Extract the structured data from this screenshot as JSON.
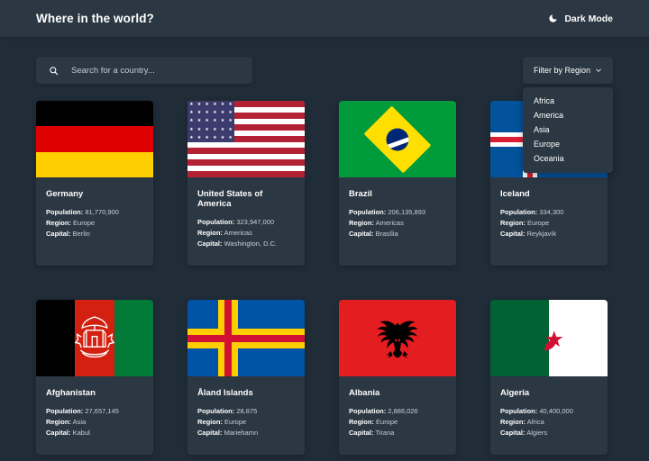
{
  "header": {
    "title": "Where in the world?",
    "theme_toggle_label": "Dark Mode",
    "theme_toggle_icon": "moon-icon"
  },
  "controls": {
    "search": {
      "icon": "search-icon",
      "placeholder": "Search for a country...",
      "value": ""
    },
    "filter": {
      "label": "Filter by Region",
      "icon": "chevron-down-icon",
      "expanded": true,
      "options": [
        "Africa",
        "America",
        "Asia",
        "Europe",
        "Oceania"
      ]
    }
  },
  "labels": {
    "population": "Population:",
    "region": "Region:",
    "capital": "Capital:"
  },
  "countries": [
    {
      "name": "Germany",
      "population": "81,770,900",
      "region": "Europe",
      "capital": "Berlin",
      "flag": "germany"
    },
    {
      "name": "United States of America",
      "population": "323,947,000",
      "region": "Americas",
      "capital": "Washington, D.C.",
      "flag": "usa"
    },
    {
      "name": "Brazil",
      "population": "206,135,893",
      "region": "Americas",
      "capital": "Brasília",
      "flag": "brazil"
    },
    {
      "name": "Iceland",
      "population": "334,300",
      "region": "Europe",
      "capital": "Reykjavík",
      "flag": "iceland"
    },
    {
      "name": "Afghanistan",
      "population": "27,657,145",
      "region": "Asia",
      "capital": "Kabul",
      "flag": "afghanistan"
    },
    {
      "name": "Åland Islands",
      "population": "28,875",
      "region": "Europe",
      "capital": "Mariehamn",
      "flag": "aland"
    },
    {
      "name": "Albania",
      "population": "2,886,026",
      "region": "Europe",
      "capital": "Tirana",
      "flag": "albania"
    },
    {
      "name": "Algeria",
      "population": "40,400,000",
      "region": "Africa",
      "capital": "Algiers",
      "flag": "algeria"
    }
  ],
  "colors": {
    "page_background": "#202c37",
    "surface": "#2b3743",
    "text_primary": "#ffffff",
    "text_secondary": "#c8d0d8"
  }
}
